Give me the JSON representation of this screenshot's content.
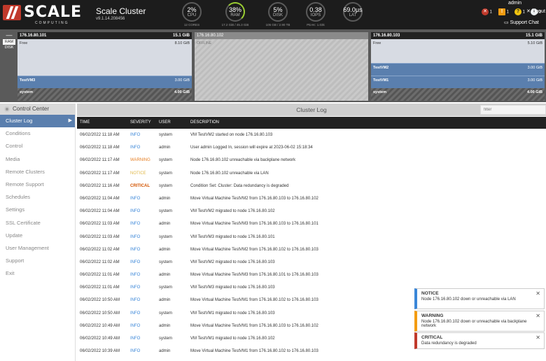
{
  "header": {
    "logo": {
      "word": "SCALE",
      "sub": "COMPUTING"
    },
    "cluster_name": "Scale Cluster",
    "version": "v9.1.14.208456",
    "gauges": [
      {
        "value": "2%",
        "label": "CPU",
        "sub": "12 CORES"
      },
      {
        "value": "38%",
        "label": "RAM",
        "sub": "17.2 GiB / 45.3 GiB"
      },
      {
        "value": "5%",
        "label": "DISK",
        "sub": "105 GB / 2.90 TB"
      },
      {
        "value": "0.38",
        "label": "IOPS",
        "sub": "PEAK: 1.03k"
      },
      {
        "value": "69.0μs",
        "label": "LAT",
        "sub": ""
      }
    ],
    "status": {
      "errors": "1",
      "warnings": "1",
      "questions": "1",
      "info": "1"
    },
    "user": "admin",
    "logout": "logout",
    "support_chat": "Support Chat",
    "colors": {
      "bg": "#1c1c1c",
      "accent": "#9acd32",
      "brand": "#c0392b"
    }
  },
  "nodes": {
    "toggle": {
      "ram": "RAM",
      "disk": "DISK"
    },
    "list": [
      {
        "ip": "176.16.80.101",
        "total": "15.1 GiB",
        "free_label": "Free",
        "free_amt": "8.10 GiB",
        "vms": [
          {
            "name": "TestVM3",
            "amt": "3.00 GiB"
          }
        ],
        "system_label": "system",
        "system_amt": "4.00 GiB"
      },
      {
        "ip": "176.16.80.102",
        "status": "OFFLINE"
      },
      {
        "ip": "176.16.80.103",
        "total": "15.1 GiB",
        "free_label": "Free",
        "free_amt": "5.10 GiB",
        "vms": [
          {
            "name": "TestVM2",
            "amt": "3.00 GiB"
          },
          {
            "name": "TestVM1",
            "amt": "3.00 GiB"
          }
        ],
        "system_label": "system",
        "system_amt": "4.00 GiB"
      }
    ]
  },
  "sidebar": {
    "title": "Control Center",
    "items": [
      {
        "label": "Cluster Log",
        "active": true
      },
      {
        "label": "Conditions"
      },
      {
        "label": "Control"
      },
      {
        "label": "Media"
      },
      {
        "label": "Remote Clusters"
      },
      {
        "label": "Remote Support"
      },
      {
        "label": "Schedules"
      },
      {
        "label": "Settings"
      },
      {
        "label": "SSL Certificate"
      },
      {
        "label": "Update"
      },
      {
        "label": "User Management"
      },
      {
        "label": "Support"
      },
      {
        "label": "Exit"
      }
    ]
  },
  "log": {
    "title": "Cluster Log",
    "filter_placeholder": "filter",
    "columns": [
      "TIME",
      "SEVERITY",
      "USER",
      "DESCRIPTION"
    ],
    "rows": [
      {
        "time": "06/02/2022 11:18 AM",
        "severity": "INFO",
        "user": "system",
        "desc": "VM TestVM2 started on node 176.16.80.103"
      },
      {
        "time": "06/02/2022 11:18 AM",
        "severity": "INFO",
        "user": "admin",
        "desc": "User admin Logged In, session will expire at 2023-06-02 15:18:34"
      },
      {
        "time": "06/02/2022 11:17 AM",
        "severity": "WARNING",
        "user": "system",
        "desc": "Node 176.16.80.102 unreachable via backplane network"
      },
      {
        "time": "06/02/2022 11:17 AM",
        "severity": "NOTICE",
        "user": "system",
        "desc": "Node 176.16.80.102 unreachable via LAN"
      },
      {
        "time": "06/02/2022 11:16 AM",
        "severity": "CRITICAL",
        "user": "system",
        "desc": "Condition Set: Cluster: Data redundancy is degraded"
      },
      {
        "time": "06/02/2022 11:04 AM",
        "severity": "INFO",
        "user": "admin",
        "desc": "Move Virtual Machine TestVM2 from 176.16.80.103 to 176.16.80.102"
      },
      {
        "time": "06/02/2022 11:04 AM",
        "severity": "INFO",
        "user": "system",
        "desc": "VM TestVM2 migrated to node 176.16.80.102"
      },
      {
        "time": "06/02/2022 11:03 AM",
        "severity": "INFO",
        "user": "admin",
        "desc": "Move Virtual Machine TestVM3 from 176.16.80.103 to 176.16.80.101"
      },
      {
        "time": "06/02/2022 11:03 AM",
        "severity": "INFO",
        "user": "system",
        "desc": "VM TestVM3 migrated to node 176.16.80.101"
      },
      {
        "time": "06/02/2022 11:02 AM",
        "severity": "INFO",
        "user": "admin",
        "desc": "Move Virtual Machine TestVM2 from 176.16.80.102 to 176.16.80.103"
      },
      {
        "time": "06/02/2022 11:02 AM",
        "severity": "INFO",
        "user": "system",
        "desc": "VM TestVM2 migrated to node 176.16.80.103"
      },
      {
        "time": "06/02/2022 11:01 AM",
        "severity": "INFO",
        "user": "admin",
        "desc": "Move Virtual Machine TestVM3 from 176.16.80.101 to 176.16.80.103"
      },
      {
        "time": "06/02/2022 11:01 AM",
        "severity": "INFO",
        "user": "system",
        "desc": "VM TestVM3 migrated to node 176.16.80.103"
      },
      {
        "time": "06/02/2022 10:50 AM",
        "severity": "INFO",
        "user": "admin",
        "desc": "Move Virtual Machine TestVM1 from 176.16.80.102 to 176.16.80.103"
      },
      {
        "time": "06/02/2022 10:50 AM",
        "severity": "INFO",
        "user": "system",
        "desc": "VM TestVM1 migrated to node 176.16.80.103"
      },
      {
        "time": "06/02/2022 10:49 AM",
        "severity": "INFO",
        "user": "admin",
        "desc": "Move Virtual Machine TestVM1 from 176.16.80.103 to 176.16.80.102"
      },
      {
        "time": "06/02/2022 10:49 AM",
        "severity": "INFO",
        "user": "system",
        "desc": "VM TestVM1 migrated to node 176.16.80.102"
      },
      {
        "time": "06/02/2022 10:39 AM",
        "severity": "INFO",
        "user": "admin",
        "desc": "Move Virtual Machine TestVM1 from 176.16.80.102 to 176.16.80.103"
      }
    ]
  },
  "toasts": [
    {
      "title": "NOTICE",
      "text": "Node 176.16.80.102 down or unreachable via LAN",
      "close": "✕"
    },
    {
      "title": "WARNING",
      "text": "Node 176.16.80.102 down or unreachable via backplane network",
      "close": "✕"
    },
    {
      "title": "CRITICAL",
      "text": "Data redundancy is degraded",
      "close": "✕"
    }
  ]
}
